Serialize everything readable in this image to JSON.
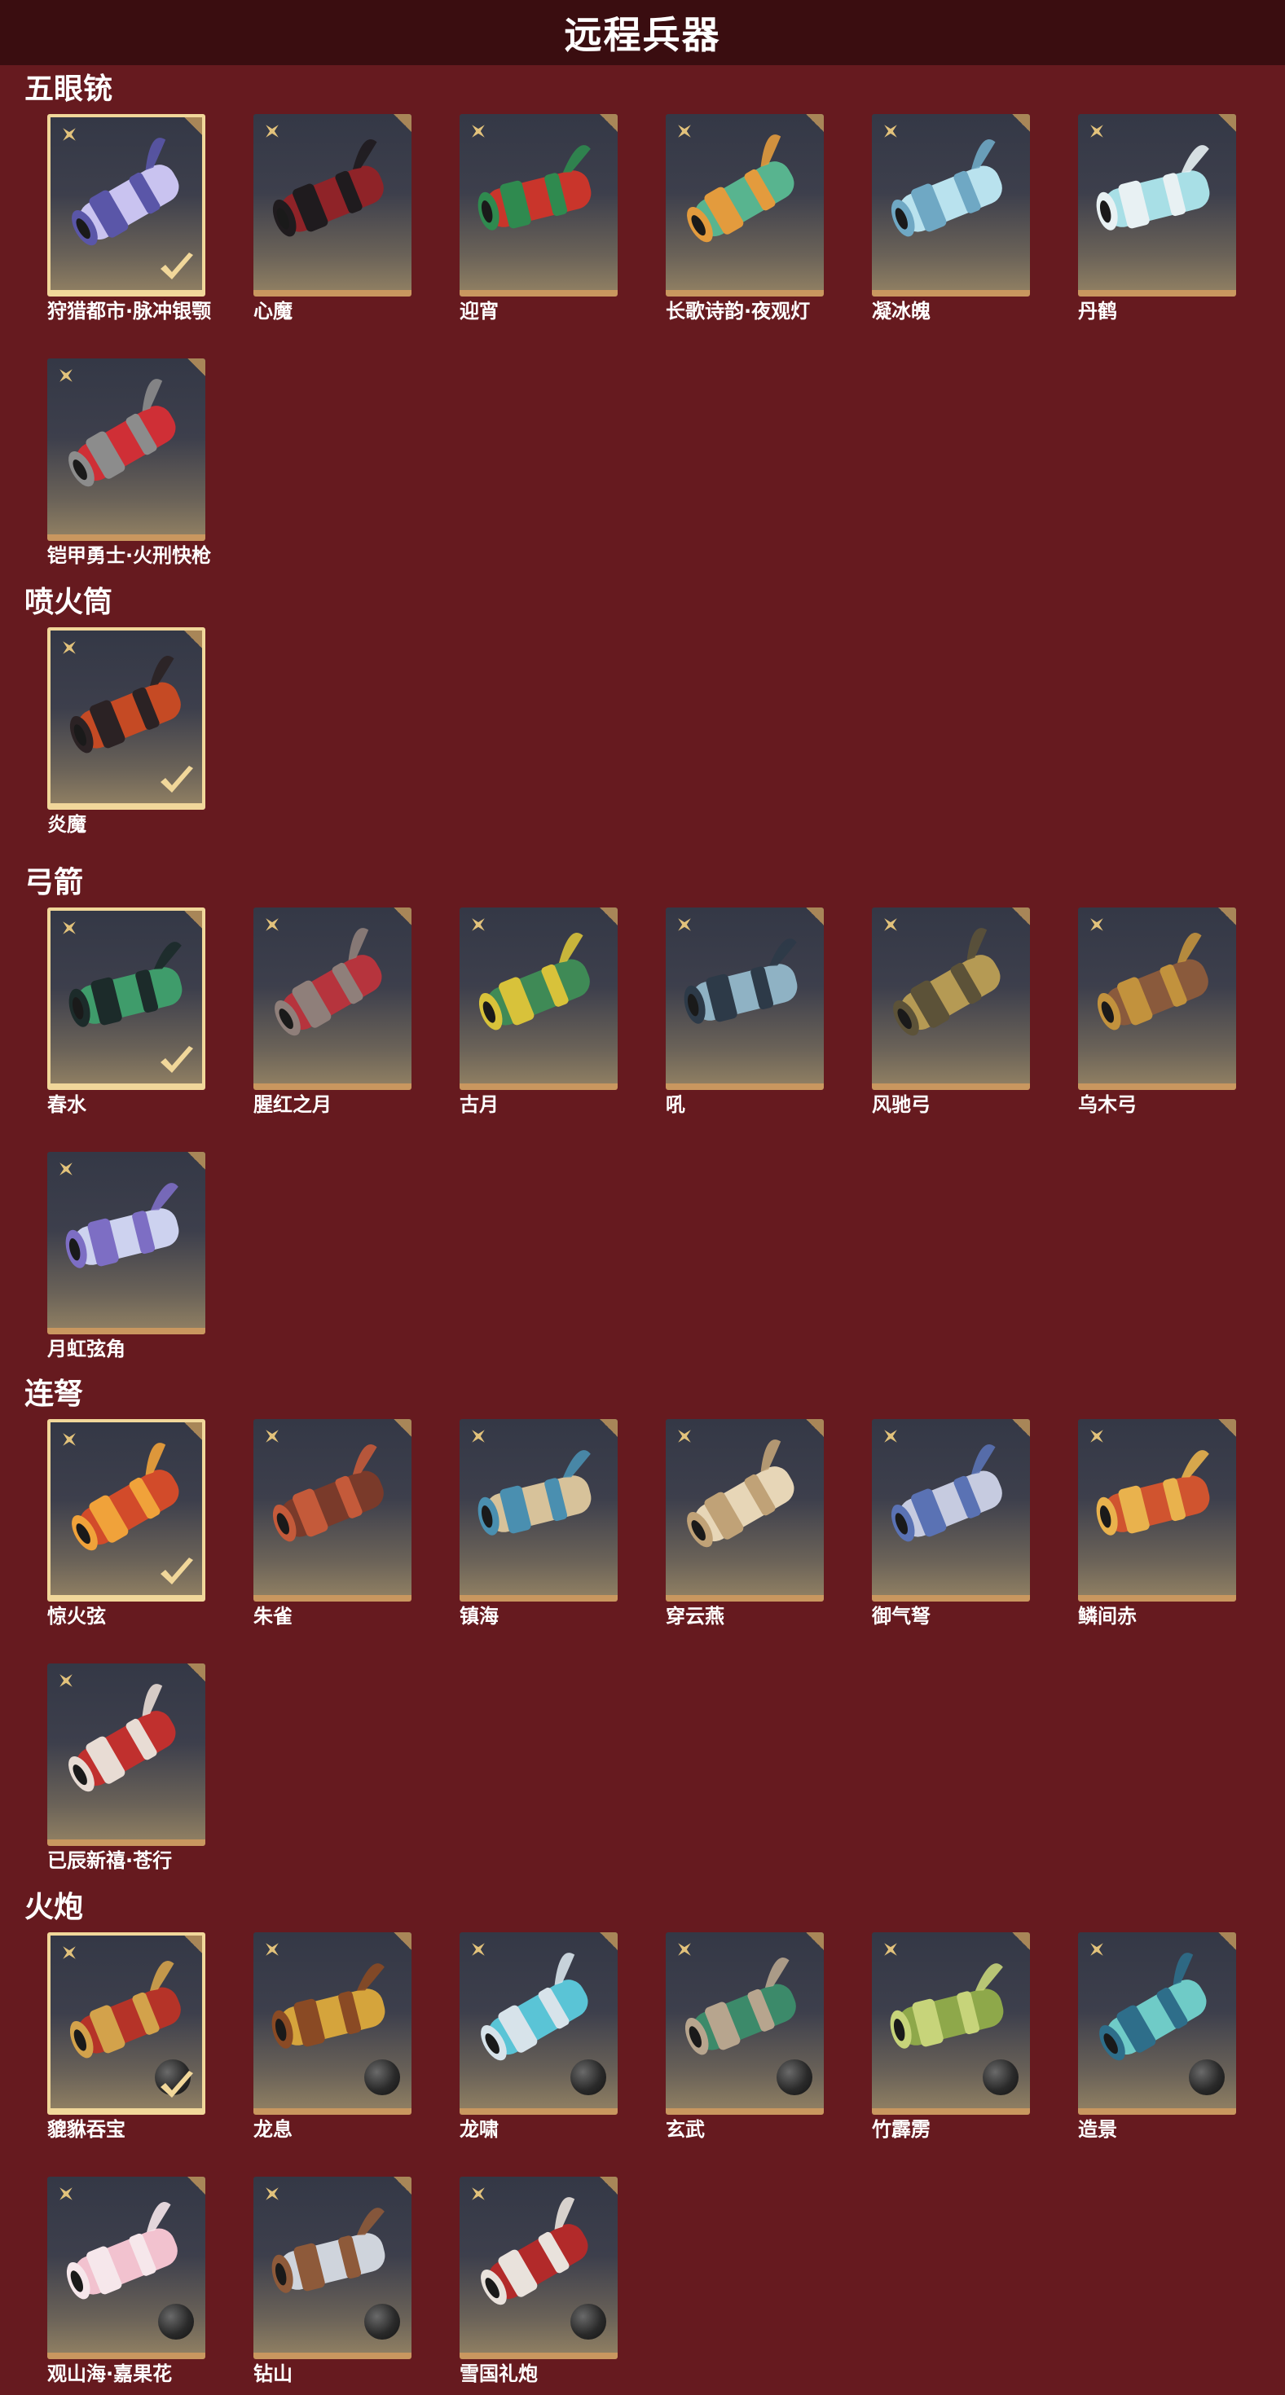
{
  "title": "远程兵器",
  "colors": {
    "background": "#661a1f",
    "title_bar": "#3a0d10",
    "card_border": "#c9975f",
    "selected_border": "#f1d79a",
    "star": "#e2c27b"
  },
  "sections": [
    {
      "name": "五眼铳",
      "items": [
        {
          "label": "狩猎都市·脉冲银颚",
          "selected": true,
          "palette": [
            "#c9c3f0",
            "#5a56a8"
          ]
        },
        {
          "label": "心魔",
          "selected": false,
          "palette": [
            "#8f2328",
            "#1f1b1e"
          ]
        },
        {
          "label": "迎宵",
          "selected": false,
          "palette": [
            "#c9352b",
            "#2f8a4f"
          ]
        },
        {
          "label": "长歌诗韵·夜观灯",
          "selected": false,
          "palette": [
            "#58b48f",
            "#e39b3d"
          ]
        },
        {
          "label": "凝冰魄",
          "selected": false,
          "palette": [
            "#b9e2ee",
            "#6fa8c4"
          ]
        },
        {
          "label": "丹鹤",
          "selected": false,
          "palette": [
            "#a8dfe6",
            "#e8f1f3"
          ]
        },
        {
          "label": "铠甲勇士·火刑快枪",
          "selected": false,
          "palette": [
            "#cf2f36",
            "#8c8c8c"
          ]
        }
      ]
    },
    {
      "name": "喷火筒",
      "items": [
        {
          "label": "炎魔",
          "selected": true,
          "palette": [
            "#c54a24",
            "#2b2224"
          ]
        }
      ]
    },
    {
      "name": "弓箭",
      "items": [
        {
          "label": "春水",
          "selected": true,
          "palette": [
            "#3f9c6b",
            "#1c2b2a"
          ]
        },
        {
          "label": "腥红之月",
          "selected": false,
          "palette": [
            "#b6343d",
            "#8f7f7a"
          ]
        },
        {
          "label": "古月",
          "selected": false,
          "palette": [
            "#3f8a56",
            "#d8c23a"
          ]
        },
        {
          "label": "吼",
          "selected": false,
          "palette": [
            "#8fb2c4",
            "#2d3a48"
          ]
        },
        {
          "label": "风驰弓",
          "selected": false,
          "palette": [
            "#b59a54",
            "#5c5238"
          ]
        },
        {
          "label": "乌木弓",
          "selected": false,
          "palette": [
            "#8a5a3c",
            "#c2923d"
          ]
        },
        {
          "label": "月虹弦角",
          "selected": false,
          "palette": [
            "#cdd2ef",
            "#7d6ec4"
          ]
        }
      ]
    },
    {
      "name": "连弩",
      "items": [
        {
          "label": "惊火弦",
          "selected": true,
          "palette": [
            "#d24b2a",
            "#f0a23a"
          ]
        },
        {
          "label": "朱雀",
          "selected": false,
          "palette": [
            "#7a3a2a",
            "#c45a3a"
          ]
        },
        {
          "label": "镇海",
          "selected": false,
          "palette": [
            "#d7c29a",
            "#4a8fb0"
          ]
        },
        {
          "label": "穿云燕",
          "selected": false,
          "palette": [
            "#e7d6b7",
            "#c0a277"
          ]
        },
        {
          "label": "御气弩",
          "selected": false,
          "palette": [
            "#c6cbe0",
            "#5a72b4"
          ]
        },
        {
          "label": "鳞间赤",
          "selected": false,
          "palette": [
            "#d0542f",
            "#e9b24d"
          ]
        },
        {
          "label": "已辰新禧·苍行",
          "selected": false,
          "palette": [
            "#c0302e",
            "#e8dcd4"
          ]
        }
      ]
    },
    {
      "name": "火炮",
      "items": [
        {
          "label": "貔貅吞宝",
          "selected": true,
          "palette": [
            "#b53328",
            "#d3a24b"
          ],
          "ball": true
        },
        {
          "label": "龙息",
          "selected": false,
          "palette": [
            "#d5a43c",
            "#8a4a24"
          ],
          "ball": true
        },
        {
          "label": "龙啸",
          "selected": false,
          "palette": [
            "#5ac4d6",
            "#d7e3ea"
          ],
          "ball": true
        },
        {
          "label": "玄武",
          "selected": false,
          "palette": [
            "#3c8a6a",
            "#b7a58e"
          ],
          "ball": true
        },
        {
          "label": "竹霹雳",
          "selected": false,
          "palette": [
            "#8ea84a",
            "#c7d47a"
          ],
          "ball": true
        },
        {
          "label": "造景",
          "selected": false,
          "palette": [
            "#6fcbc7",
            "#2e6e8a"
          ],
          "ball": true
        },
        {
          "label": "观山海·嘉果花",
          "selected": false,
          "palette": [
            "#f2c2cf",
            "#f6e7eb"
          ],
          "ball": true
        },
        {
          "label": "钻山",
          "selected": false,
          "palette": [
            "#cfd4dc",
            "#8e5a3a"
          ],
          "ball": true
        },
        {
          "label": "雪国礼炮",
          "selected": false,
          "palette": [
            "#b22a2a",
            "#e9e2dc"
          ],
          "ball": true
        }
      ]
    }
  ]
}
